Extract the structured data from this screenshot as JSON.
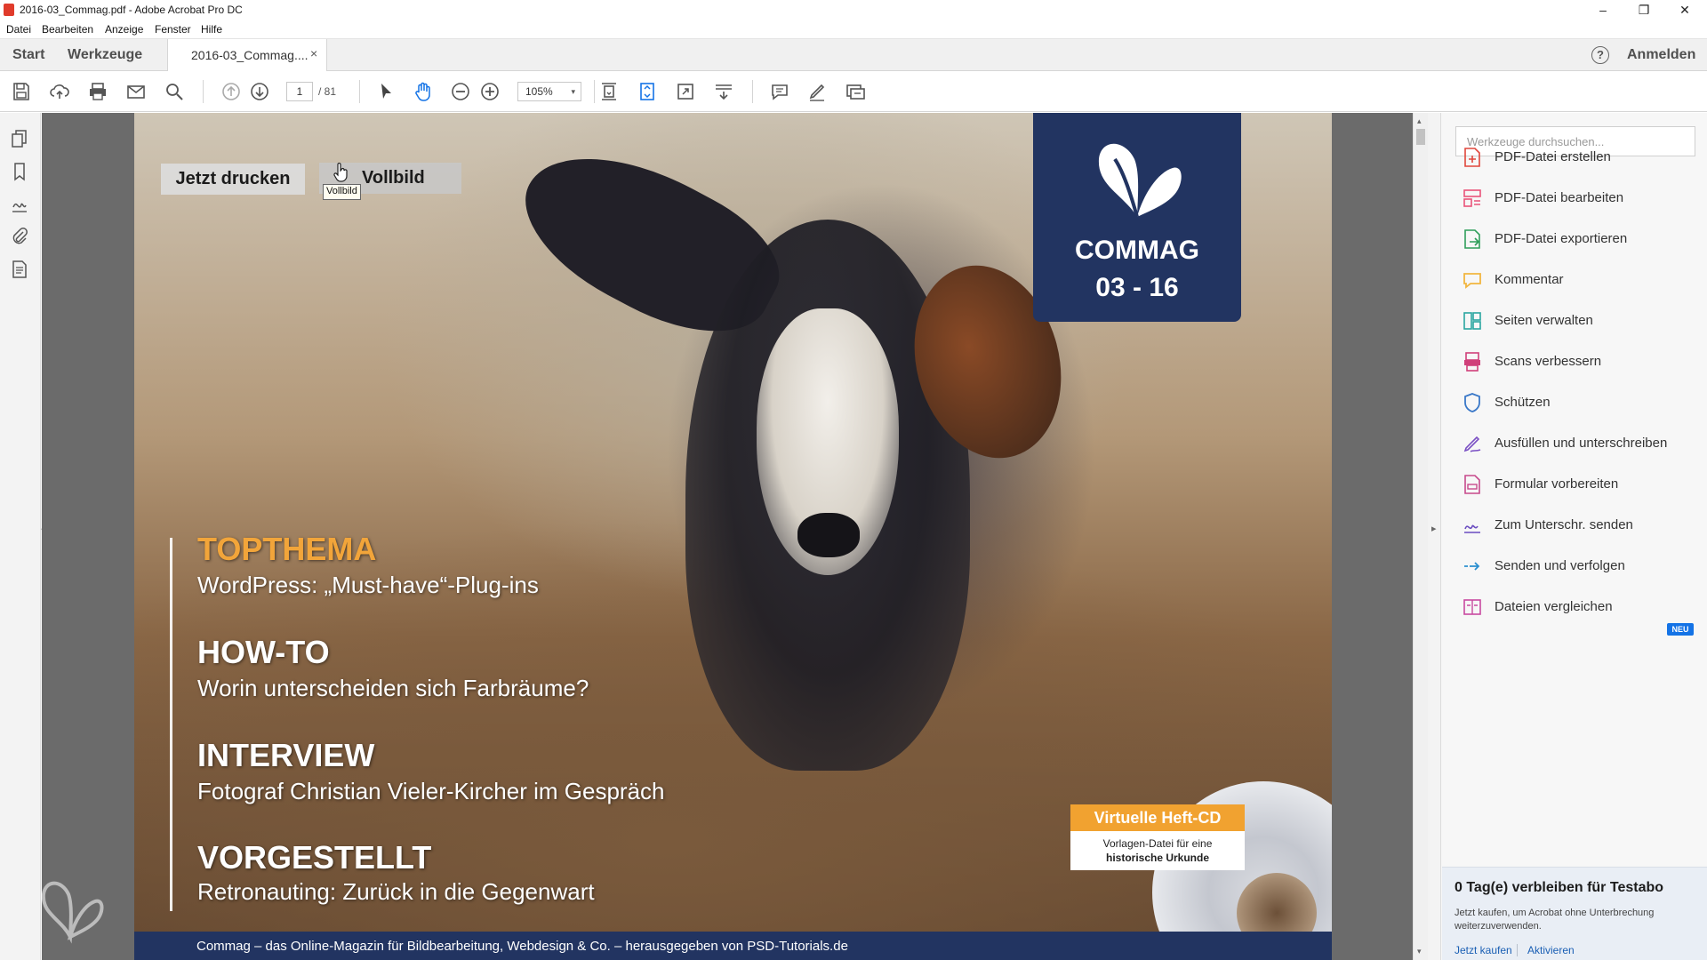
{
  "window": {
    "title": "2016-03_Commag.pdf - Adobe Acrobat Pro DC",
    "minimize": "–",
    "restore": "❐",
    "close": "✕"
  },
  "menu": [
    "Datei",
    "Bearbeiten",
    "Anzeige",
    "Fenster",
    "Hilfe"
  ],
  "tabs": {
    "home": "Start",
    "tools": "Werkzeuge",
    "document": "2016-03_Commag....",
    "close": "×",
    "help": "?",
    "signin": "Anmelden"
  },
  "toolbar": {
    "page_current": "1",
    "page_total": "/ 81",
    "zoom": "105%",
    "zoom_caret": "▾",
    "icons": [
      "save-icon",
      "upload-icon",
      "print-icon",
      "email-icon",
      "search-icon",
      "prev-page-icon",
      "next-page-icon",
      "select-cursor-icon",
      "hand-tool-icon",
      "zoom-out-icon",
      "zoom-in-icon",
      "fit-page-icon",
      "scroll-mode-icon",
      "full-screen-icon",
      "read-mode-icon",
      "comment-icon",
      "highlight-pen-icon",
      "share-icon"
    ]
  },
  "left_pane": {
    "icons": [
      "page-thumbnails-icon",
      "bookmarks-icon",
      "signatures-icon",
      "attachments-icon",
      "document-properties-icon"
    ],
    "collapse": "◂"
  },
  "document": {
    "print_button": "Jetzt drucken",
    "fullscreen_button": "Vollbild",
    "tooltip": "Vollbild",
    "badge_brand": "COMMAG",
    "badge_issue": "03 - 16",
    "sections": [
      {
        "heading": "TOPTHEMA",
        "sub": "WordPress: „Must-have“-Plug-ins"
      },
      {
        "heading": "HOW-TO",
        "sub": "Worin unterscheiden sich Farbräume?"
      },
      {
        "heading": "INTERVIEW",
        "sub": "Fotograf Christian Vieler-Kircher im Gespräch"
      },
      {
        "heading": "VORGESTELLT",
        "sub": "Retronauting: Zurück in die Gegenwart"
      }
    ],
    "cd_title": "Virtuelle Heft-CD",
    "cd_line1": "Vorlagen-Datei für eine",
    "cd_line2": "historische Urkunde",
    "footer": "Commag – das Online-Magazin für Bildbearbeitung, Webdesign & Co. – herausgegeben von PSD-Tutorials.de",
    "colors": {
      "navy": "#223461",
      "orange": "#f2a53a",
      "cd_orange": "#f1a230"
    }
  },
  "scrollbar": {
    "up": "▴",
    "down": "▾"
  },
  "right_pane": {
    "collapse": "▸",
    "search_placeholder": "Werkzeuge durchsuchen...",
    "tools": [
      {
        "label": "PDF-Datei erstellen",
        "icon": "create-pdf-icon",
        "color": "#e0463b"
      },
      {
        "label": "PDF-Datei bearbeiten",
        "icon": "edit-pdf-icon",
        "color": "#e9547a"
      },
      {
        "label": "PDF-Datei exportieren",
        "icon": "export-pdf-icon",
        "color": "#2f9e5a"
      },
      {
        "label": "Kommentar",
        "icon": "comment-icon",
        "color": "#f2b640"
      },
      {
        "label": "Seiten verwalten",
        "icon": "organize-pages-icon",
        "color": "#2aa6a0"
      },
      {
        "label": "Scans verbessern",
        "icon": "enhance-scans-icon",
        "color": "#d0407a"
      },
      {
        "label": "Schützen",
        "icon": "protect-shield-icon",
        "color": "#3a78c8"
      },
      {
        "label": "Ausfüllen und unterschreiben",
        "icon": "fill-sign-icon",
        "color": "#7a4fc4"
      },
      {
        "label": "Formular vorbereiten",
        "icon": "prepare-form-icon",
        "color": "#c74a8c"
      },
      {
        "label": "Zum Unterschr. senden",
        "icon": "send-for-signature-icon",
        "color": "#6a4cc0"
      },
      {
        "label": "Senden und verfolgen",
        "icon": "send-track-icon",
        "color": "#2b8fd0"
      },
      {
        "label": "Dateien vergleichen",
        "icon": "compare-files-icon",
        "color": "#c94aa0"
      }
    ],
    "new_badge": "NEU"
  },
  "trial": {
    "title": "0 Tag(e) verbleiben für Testabo",
    "body": "Jetzt kaufen, um Acrobat ohne Unterbrechung weiterzuverwenden.",
    "buy": "Jetzt kaufen",
    "activate": "Aktivieren"
  }
}
